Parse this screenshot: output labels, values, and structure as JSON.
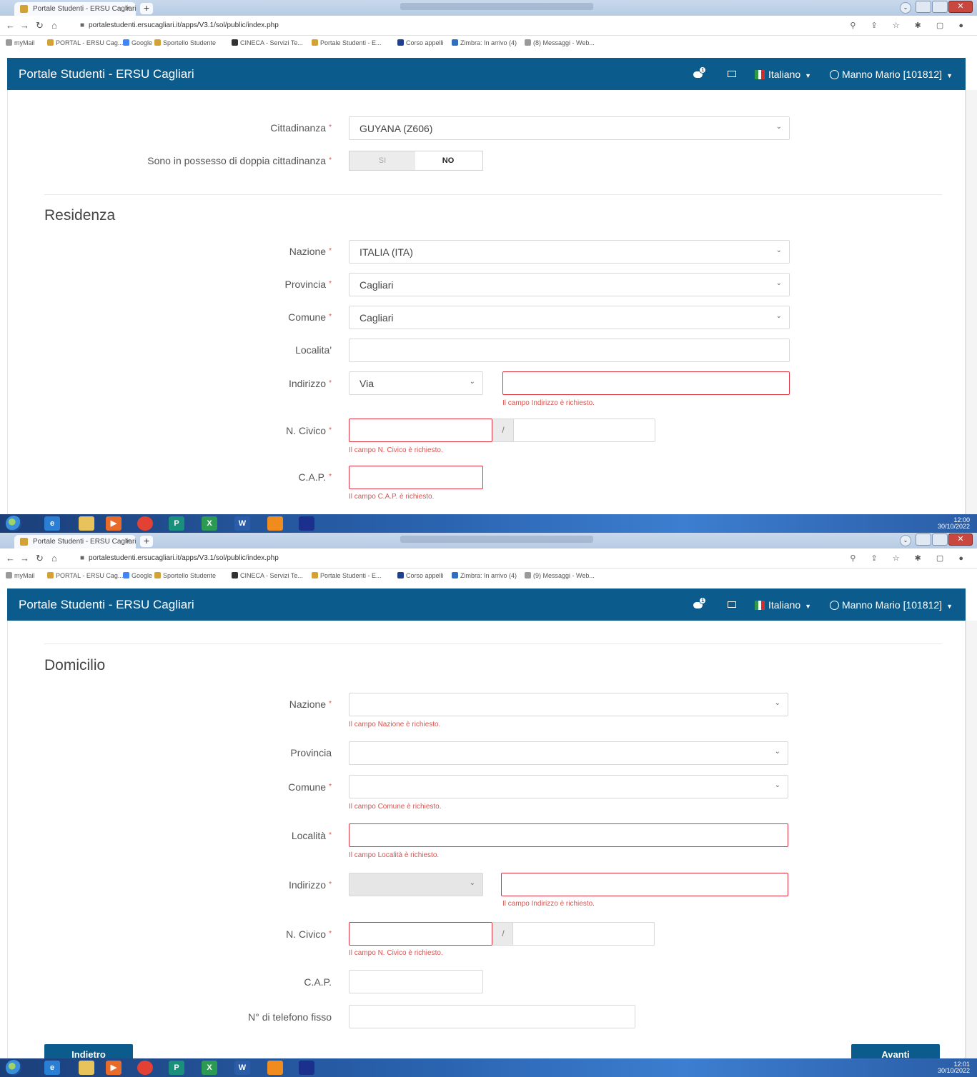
{
  "browser": {
    "tab_title": "Portale Studenti - ERSU Cagliari",
    "tab_close": "×",
    "new_tab": "+",
    "url": "portalestudenti.ersucagliari.it/apps/V3.1/sol/public/index.php",
    "bookmarks": [
      {
        "label": "myMail",
        "color": "#9a9a9a"
      },
      {
        "label": "PORTAL - ERSU Cag...",
        "color": "#d3a237"
      },
      {
        "label": "Google",
        "color": "#4285f4"
      },
      {
        "label": "Sportello Studente",
        "color": "#d3a237"
      },
      {
        "label": "CINECA - Servizi Te...",
        "color": "#333333"
      },
      {
        "label": "Portale Studenti - E...",
        "color": "#d3a237"
      },
      {
        "label": "Corso appelli",
        "color": "#1f3f8f"
      },
      {
        "label": "Zimbra: In arrivo (4)",
        "color": "#2f6fc0"
      },
      {
        "label": "(8) Messaggi - Web...",
        "color": "#9a9a9a"
      }
    ],
    "bookmarks_2_last": "(9) Messaggi - Web..."
  },
  "navbar": {
    "brand": "Portale Studenti - ERSU Cagliari",
    "chat_badge": "1",
    "language": "Italiano",
    "user": "Manno Mario [101812]",
    "flag_colors": [
      "#2e9a47",
      "#ffffff",
      "#d32f2f"
    ]
  },
  "shot1": {
    "cittadinanza": {
      "label": "Cittadinanza",
      "value": "GUYANA (Z606)"
    },
    "doppia": {
      "label": "Sono in possesso di doppia cittadinanza",
      "si": "SI",
      "no": "NO"
    },
    "residenza_title": "Residenza",
    "nazione": {
      "label": "Nazione",
      "value": "ITALIA (ITA)"
    },
    "provincia": {
      "label": "Provincia",
      "value": "Cagliari"
    },
    "comune": {
      "label": "Comune",
      "value": "Cagliari"
    },
    "localita": {
      "label": "Localita'",
      "value": ""
    },
    "indirizzo": {
      "label": "Indirizzo",
      "type_value": "Via",
      "value": "",
      "error": "Il campo Indirizzo è richiesto."
    },
    "civico": {
      "label": "N. Civico",
      "slash": "/",
      "error": "Il campo N. Civico è richiesto."
    },
    "cap": {
      "label": "C.A.P.",
      "error": "Il campo C.A.P. è richiesto."
    },
    "clock_time": "12:00",
    "clock_date": "30/10/2022"
  },
  "shot2": {
    "domicilio_title": "Domicilio",
    "nazione": {
      "label": "Nazione",
      "error": "Il campo Nazione è richiesto."
    },
    "provincia": {
      "label": "Provincia"
    },
    "comune": {
      "label": "Comune",
      "error": "Il campo Comune è richiesto."
    },
    "localita": {
      "label": "Località",
      "error": "Il campo Località è richiesto."
    },
    "indirizzo": {
      "label": "Indirizzo",
      "error": "Il campo Indirizzo è richiesto."
    },
    "civico": {
      "label": "N. Civico",
      "slash": "/",
      "error": "Il campo N. Civico è richiesto."
    },
    "cap": {
      "label": "C.A.P."
    },
    "telefono": {
      "label": "N° di telefono fisso"
    },
    "back_button": "Indietro",
    "next_button": "Avanti",
    "clock_time": "12:01",
    "clock_date": "30/10/2022"
  },
  "taskbar_icons": [
    {
      "name": "ie-icon",
      "glyph": "e",
      "color": "#2a7fd4"
    },
    {
      "name": "explorer-icon",
      "glyph": "",
      "color": "#e8c25a"
    },
    {
      "name": "media-player-icon",
      "glyph": "▶",
      "color": "#e96b2a"
    },
    {
      "name": "chrome-icon",
      "glyph": "",
      "color": "#e34133"
    },
    {
      "name": "publisher-icon",
      "glyph": "P",
      "color": "#1a8f7b"
    },
    {
      "name": "excel-icon",
      "glyph": "X",
      "color": "#2c9a52"
    },
    {
      "name": "word-icon",
      "glyph": "W",
      "color": "#2b5ca8"
    },
    {
      "name": "app-orange-icon",
      "glyph": "",
      "color": "#f08c1d"
    },
    {
      "name": "app-blue-icon",
      "glyph": "",
      "color": "#1b2f8c"
    }
  ]
}
